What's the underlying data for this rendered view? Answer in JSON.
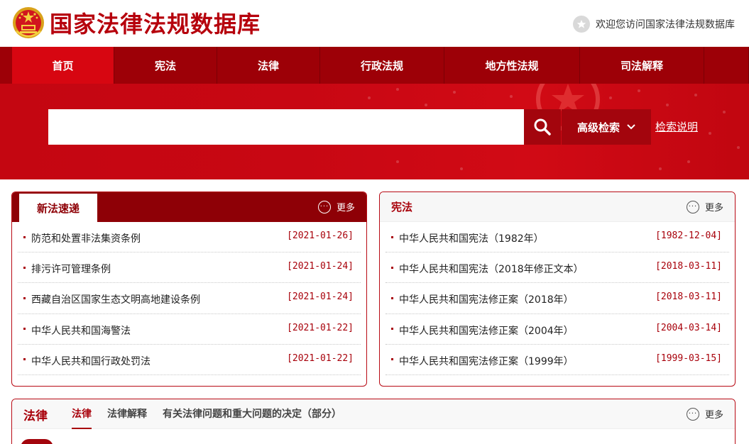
{
  "header": {
    "site_title": "国家法律法规数据库",
    "welcome_text": "欢迎您访问国家法律法规数据库",
    "welcome_icon": "star-icon"
  },
  "nav": {
    "items": [
      {
        "label": "首页",
        "active": true
      },
      {
        "label": "宪法"
      },
      {
        "label": "法律"
      },
      {
        "label": "行政法规"
      },
      {
        "label": "地方性法规"
      },
      {
        "label": "司法解释"
      }
    ]
  },
  "search": {
    "placeholder": "",
    "value": "",
    "advanced_label": "高级检索",
    "help_label": "检索说明"
  },
  "new_laws": {
    "tab_label": "新法速递",
    "more_label": "更多",
    "items": [
      {
        "title": "防范和处置非法集资条例",
        "date": "[2021-01-26]"
      },
      {
        "title": "排污许可管理条例",
        "date": "[2021-01-24]"
      },
      {
        "title": "西藏自治区国家生态文明高地建设条例",
        "date": "[2021-01-24]"
      },
      {
        "title": "中华人民共和国海警法",
        "date": "[2021-01-22]"
      },
      {
        "title": "中华人民共和国行政处罚法",
        "date": "[2021-01-22]"
      }
    ]
  },
  "constitution": {
    "title": "宪法",
    "more_label": "更多",
    "items": [
      {
        "title": "中华人民共和国宪法（1982年）",
        "date": "[1982-12-04]"
      },
      {
        "title": "中华人民共和国宪法（2018年修正文本）",
        "date": "[2018-03-11]"
      },
      {
        "title": "中华人民共和国宪法修正案（2018年）",
        "date": "[2018-03-11]"
      },
      {
        "title": "中华人民共和国宪法修正案（2004年）",
        "date": "[2004-03-14]"
      },
      {
        "title": "中华人民共和国宪法修正案（1999年）",
        "date": "[1999-03-15]"
      }
    ]
  },
  "laws": {
    "title": "法律",
    "tabs": [
      {
        "label": "法律",
        "active": true
      },
      {
        "label": "法律解释"
      },
      {
        "label": "有关法律问题和重大问题的决定（部分）"
      }
    ],
    "more_label": "更多"
  },
  "colors": {
    "brand_red": "#b6000c",
    "nav_red": "#9d0007",
    "active_red": "#d70611"
  }
}
